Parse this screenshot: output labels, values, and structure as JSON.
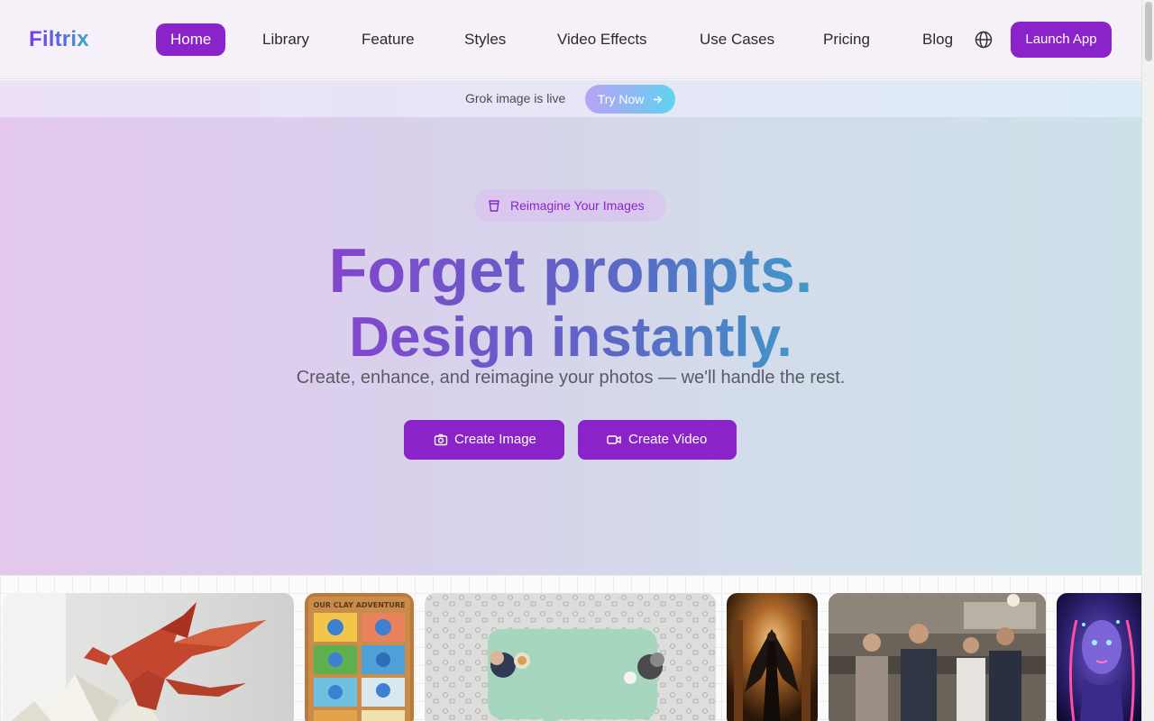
{
  "brand": {
    "name": "Filtrix"
  },
  "nav": {
    "items": [
      {
        "label": "Home",
        "active": true
      },
      {
        "label": "Library"
      },
      {
        "label": "Feature"
      },
      {
        "label": "Styles"
      },
      {
        "label": "Video Effects"
      },
      {
        "label": "Use Cases"
      },
      {
        "label": "Pricing"
      },
      {
        "label": "Blog"
      }
    ],
    "language_icon": "globe-icon",
    "launch_label": "Launch App"
  },
  "announcement": {
    "text": "Grok image is live",
    "button_label": "Try Now",
    "button_icon": "arrow-right-icon"
  },
  "hero": {
    "badge_icon": "sparkle-cup-icon",
    "badge_text": "Reimagine Your Images",
    "headline_line1": "Forget prompts.",
    "headline_line2": "Design instantly.",
    "subtitle": "Create, enhance, and reimagine your photos — we'll handle the rest.",
    "cta_image_label": "Create Image",
    "cta_image_icon": "camera-icon",
    "cta_video_label": "Create Video",
    "cta_video_icon": "video-camera-icon"
  },
  "gallery": {
    "items": [
      {
        "name": "origami-dragon-image"
      },
      {
        "name": "clay-adventure-comic-image",
        "caption": "OUR CLAY ADVENTURE"
      },
      {
        "name": "speech-bubble-table-image"
      },
      {
        "name": "dark-angel-image"
      },
      {
        "name": "kitchen-friends-image"
      },
      {
        "name": "neon-face-image"
      }
    ]
  },
  "colors": {
    "accent": "#8a23c9",
    "gradient_start": "#8a3fcf",
    "gradient_end": "#3aa5c9"
  }
}
